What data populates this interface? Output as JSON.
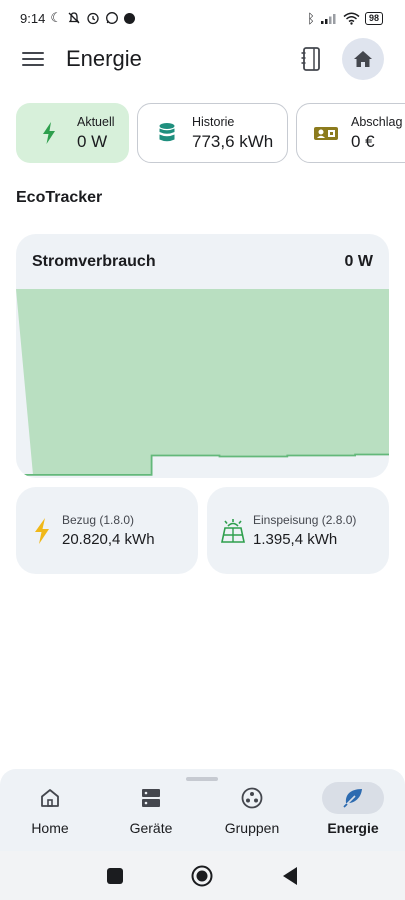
{
  "status_bar": {
    "time": "9:14",
    "battery": "98",
    "icons": [
      "moon-icon",
      "notifications-off-icon",
      "alarm-icon",
      "whatsapp-icon",
      "dot-icon",
      "bluetooth-icon",
      "signal-icon",
      "wifi-icon",
      "battery-icon"
    ]
  },
  "app_bar": {
    "title": "Energie",
    "icons": [
      "menu-icon",
      "notebook-icon",
      "home-icon"
    ]
  },
  "chips": [
    {
      "label": "Aktuell",
      "value": "0 W",
      "icon": "bolt-icon",
      "color": "#2e9f4d",
      "active": true
    },
    {
      "label": "Historie",
      "value": "773,6 kWh",
      "icon": "database-icon",
      "color": "#1f8f7e",
      "active": false
    },
    {
      "label": "Abschlag",
      "value": "0 €",
      "icon": "payment-card-icon",
      "color": "#8c7b1d",
      "active": false
    }
  ],
  "section": {
    "title": "EcoTracker"
  },
  "power_card": {
    "title": "Stromverbrauch",
    "value": "0 W"
  },
  "chart_data": {
    "type": "area",
    "series": [
      {
        "values": [
          3,
          3,
          3,
          3,
          3,
          3,
          3,
          3,
          22,
          22,
          22,
          22,
          21,
          21,
          21,
          21,
          22,
          22,
          22,
          22,
          23,
          23
        ]
      }
    ],
    "ylim": [
      0,
      185
    ],
    "grid": false,
    "colors": {
      "fill": "#b9dfc1",
      "line": "#63b87a"
    }
  },
  "meters": [
    {
      "label": "Bezug (1.8.0)",
      "value": "20.820,4 kWh",
      "icon": "bolt-icon",
      "color": "#f0b818"
    },
    {
      "label": "Einspeisung (2.8.0)",
      "value": "1.395,4 kWh",
      "icon": "solar-panel-icon",
      "color": "#2e9f4d"
    }
  ],
  "bottom_nav": [
    {
      "label": "Home",
      "icon": "home-icon",
      "active": false
    },
    {
      "label": "Geräte",
      "icon": "devices-icon",
      "active": false
    },
    {
      "label": "Gruppen",
      "icon": "groups-icon",
      "active": false
    },
    {
      "label": "Energie",
      "icon": "leaf-icon",
      "active": true,
      "color": "#2d6bb0"
    }
  ],
  "system_nav": [
    "recents-icon",
    "home-circle-icon",
    "back-icon"
  ]
}
